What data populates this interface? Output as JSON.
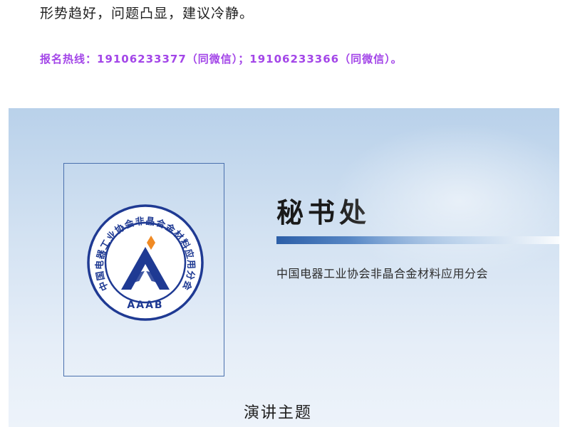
{
  "article": {
    "intro": "形势趋好，问题凸显，建议冷静。",
    "hotline": "报名热线：19106233377（同微信）；19106233366（同微信）。"
  },
  "banner": {
    "title": "秘书处",
    "org_name": "中国电器工业协会非晶合金材料应用分会",
    "topic": "演讲主题",
    "logo": {
      "ring_text": "中国电器工业协会非晶合金材料应用分会",
      "abbr": "AAAB",
      "icon": "aaab-emblem-icon"
    },
    "colors": {
      "hotline": "#a346e8",
      "logo_blue": "#1f3a93",
      "logo_orange": "#f08a24",
      "accent_bar": "#2c5fa8"
    }
  }
}
